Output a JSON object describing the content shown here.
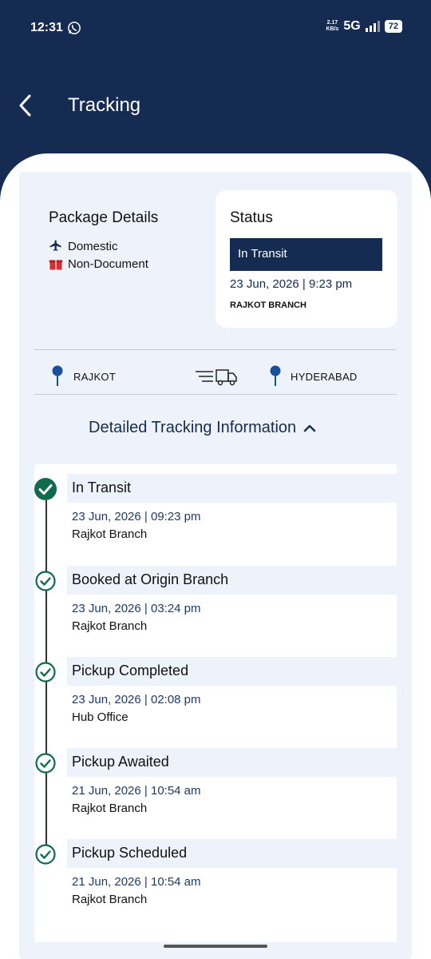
{
  "status_bar": {
    "time": "12:31",
    "speed_value": "2.17",
    "speed_unit": "KB/s",
    "network": "5G",
    "battery": "72"
  },
  "header": {
    "title": "Tracking",
    "back_icon": "arrow-left-icon"
  },
  "package": {
    "title": "Package Details",
    "type": "Domestic",
    "content": "Non-Document"
  },
  "status": {
    "label": "Status",
    "value": "In Transit",
    "datetime": "23 Jun, 2026 | 9:23 pm",
    "branch": "RAJKOT BRANCH"
  },
  "route": {
    "origin": "RAJKOT",
    "destination": "HYDERABAD"
  },
  "detail_toggle": {
    "label": "Detailed Tracking Information"
  },
  "timeline": [
    {
      "title": "In Transit",
      "datetime": "23 Jun, 2026 | 09:23 pm",
      "branch": "Rajkot Branch"
    },
    {
      "title": "Booked at Origin Branch",
      "datetime": "23 Jun, 2026 | 03:24 pm",
      "branch": "Rajkot Branch"
    },
    {
      "title": "Pickup Completed",
      "datetime": "23 Jun, 2026 | 02:08 pm",
      "branch": "Hub Office"
    },
    {
      "title": "Pickup Awaited",
      "datetime": "21 Jun, 2026 | 10:54 am",
      "branch": "Rajkot Branch"
    },
    {
      "title": "Pickup Scheduled",
      "datetime": "21 Jun, 2026 | 10:54 am",
      "branch": "Rajkot Branch"
    }
  ],
  "colors": {
    "brand_navy": "#152b52",
    "success_green": "#0f6b4e",
    "pin_blue": "#1b4f9c"
  }
}
